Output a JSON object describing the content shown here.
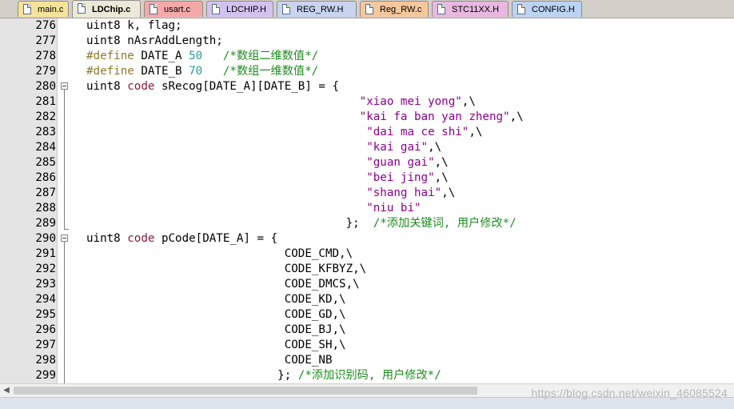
{
  "tabs": [
    {
      "label": "main.c",
      "color": "#f6e39a",
      "active": false
    },
    {
      "label": "LDChip.c",
      "color": "#d6e7a8",
      "active": true
    },
    {
      "label": "usart.c",
      "color": "#f4a8a8",
      "active": false
    },
    {
      "label": "LDCHIP.H",
      "color": "#d2c2f0",
      "active": false
    },
    {
      "label": "REG_RW.H",
      "color": "#c8d4f0",
      "active": false
    },
    {
      "label": "Reg_RW.c",
      "color": "#f7c79c",
      "active": false
    },
    {
      "label": "STC11XX.H",
      "color": "#e8b8e0",
      "active": false
    },
    {
      "label": "CONFIG.H",
      "color": "#bcd4f4",
      "active": false
    }
  ],
  "lines": [
    {
      "num": "276",
      "code": [
        [
          "",
          "uint8 k, flag;"
        ]
      ]
    },
    {
      "num": "277",
      "code": [
        [
          "",
          "uint8 nAsrAddLength;"
        ]
      ]
    },
    {
      "num": "278",
      "code": [
        [
          "pp",
          "#define"
        ],
        [
          "",
          " DATE_A "
        ],
        [
          "num",
          "50"
        ],
        [
          "",
          "   "
        ],
        [
          "cmt",
          "/*数组二维数值*/"
        ]
      ]
    },
    {
      "num": "279",
      "code": [
        [
          "pp",
          "#define"
        ],
        [
          "",
          " DATE_B "
        ],
        [
          "num",
          "70"
        ],
        [
          "",
          "   "
        ],
        [
          "cmt",
          "/*数组一维数值*/"
        ]
      ]
    },
    {
      "num": "280",
      "code": [
        [
          "",
          "uint8 "
        ],
        [
          "kw",
          "code"
        ],
        [
          "",
          " sRecog[DATE_A][DATE_B] = {"
        ]
      ]
    },
    {
      "num": "281",
      "code": [
        [
          "",
          "                                        "
        ],
        [
          "str",
          "\"xiao mei yong\""
        ],
        [
          "",
          ",\\"
        ]
      ]
    },
    {
      "num": "282",
      "code": [
        [
          "",
          "                                        "
        ],
        [
          "str",
          "\"kai fa ban yan zheng\""
        ],
        [
          "",
          ",\\"
        ]
      ]
    },
    {
      "num": "283",
      "code": [
        [
          "",
          "                                         "
        ],
        [
          "str",
          "\"dai ma ce shi\""
        ],
        [
          "",
          ",\\"
        ]
      ]
    },
    {
      "num": "284",
      "code": [
        [
          "",
          "                                         "
        ],
        [
          "str",
          "\"kai gai\""
        ],
        [
          "",
          ",\\"
        ]
      ]
    },
    {
      "num": "285",
      "code": [
        [
          "",
          "                                         "
        ],
        [
          "str",
          "\"guan gai\""
        ],
        [
          "",
          ",\\"
        ]
      ]
    },
    {
      "num": "286",
      "code": [
        [
          "",
          "                                         "
        ],
        [
          "str",
          "\"bei jing\""
        ],
        [
          "",
          ",\\"
        ]
      ]
    },
    {
      "num": "287",
      "code": [
        [
          "",
          "                                         "
        ],
        [
          "str",
          "\"shang hai\""
        ],
        [
          "",
          ",\\"
        ]
      ]
    },
    {
      "num": "288",
      "code": [
        [
          "",
          "                                         "
        ],
        [
          "str",
          "\"niu bi\""
        ]
      ]
    },
    {
      "num": "289",
      "code": [
        [
          "",
          "                                      };  "
        ],
        [
          "cmt",
          "/*添加关键词, 用户修改*/"
        ]
      ]
    },
    {
      "num": "290",
      "code": [
        [
          "",
          "uint8 "
        ],
        [
          "kw",
          "code"
        ],
        [
          "",
          " pCode[DATE_A] = {"
        ]
      ]
    },
    {
      "num": "291",
      "code": [
        [
          "",
          "                             CODE_CMD,\\"
        ]
      ]
    },
    {
      "num": "292",
      "code": [
        [
          "",
          "                             CODE_KFBYZ,\\"
        ]
      ]
    },
    {
      "num": "293",
      "code": [
        [
          "",
          "                             CODE_DMCS,\\"
        ]
      ]
    },
    {
      "num": "294",
      "code": [
        [
          "",
          "                             CODE_KD,\\"
        ]
      ]
    },
    {
      "num": "295",
      "code": [
        [
          "",
          "                             CODE_GD,\\"
        ]
      ]
    },
    {
      "num": "296",
      "code": [
        [
          "",
          "                             CODE_BJ,\\"
        ]
      ]
    },
    {
      "num": "297",
      "code": [
        [
          "",
          "                             CODE_SH,\\"
        ]
      ]
    },
    {
      "num": "298",
      "code": [
        [
          "",
          "                             CODE_NB"
        ]
      ]
    },
    {
      "num": "299",
      "code": [
        [
          "",
          "                            }; "
        ],
        [
          "cmt",
          "/*添加识别码, 用户修改*/"
        ]
      ]
    }
  ],
  "watermark": "https://blog.csdn.net/weixin_46085524",
  "scroll": {
    "left_arrow": "◀"
  }
}
